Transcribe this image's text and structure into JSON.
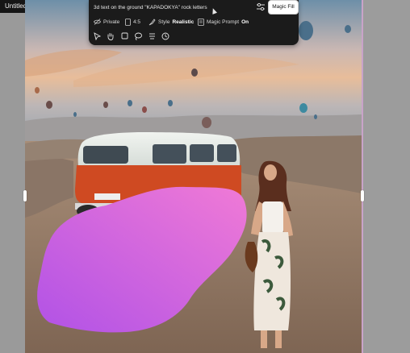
{
  "canvas": {
    "title": "Untitled canvas"
  },
  "prompt": {
    "value": "3d text on the ground \"KAPADOKYA\" rock letters",
    "placeholder": ""
  },
  "buttons": {
    "magic_fill": "Magic Fill"
  },
  "options": {
    "privacy": {
      "label": "Private"
    },
    "aspect": {
      "label": "4:5"
    },
    "style": {
      "label": "Style",
      "value": "Realistic"
    },
    "magic_prompt": {
      "label": "Magic Prompt",
      "value": "On"
    }
  },
  "tools": [
    "select-tool",
    "hand-tool",
    "rectangle-tool",
    "lasso-tool",
    "layers-tool",
    "history-tool"
  ],
  "colors": {
    "toolbar_bg": "#1b1b1b",
    "mask_start": "#b152e6",
    "mask_end": "#f07ad6"
  }
}
